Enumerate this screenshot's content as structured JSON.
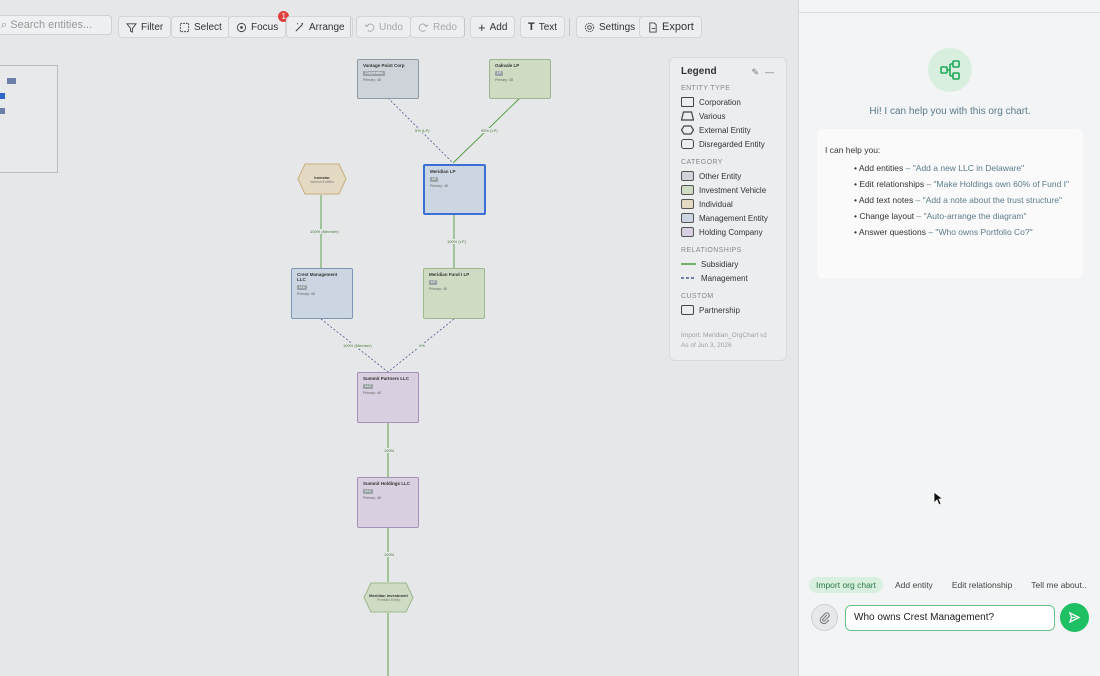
{
  "toolbar": {
    "search_placeholder": "Search entities...",
    "filter": "Filter",
    "select": "Select",
    "focus": "Focus",
    "focus_badge": "1",
    "arrange": "Arrange",
    "undo": "Undo",
    "redo": "Redo",
    "add": "Add",
    "text": "Text",
    "settings": "Settings",
    "export": "Export"
  },
  "nodes": {
    "vantage": {
      "name": "Vantage Point Corp",
      "tag": "Corporation",
      "line": "Primary: 48"
    },
    "oakvale": {
      "name": "Oakvale LP",
      "tag": "LP",
      "line": "Primary: 48"
    },
    "investor": {
      "name": "Investor",
      "line": "Various Entities"
    },
    "meridian": {
      "name": "Meridian LP",
      "tag": "LP",
      "line": "Primary: 48"
    },
    "crest": {
      "name": "Crest Management LLC",
      "tag": "LLC",
      "line": "Primary: 48"
    },
    "fund": {
      "name": "Meridian Fund I LP",
      "tag": "LP",
      "line": "Primary: 48"
    },
    "partners": {
      "name": "Summit Partners LLC",
      "tag": "LLC",
      "line": "Primary: 48"
    },
    "holdings": {
      "name": "Summit Holdings LLC",
      "tag": "LLC",
      "line": "Primary: 48"
    },
    "portfolio": {
      "name": "Meridian Investment",
      "line": "Portfolio Entity"
    }
  },
  "edges": {
    "e1": "5% (LP)",
    "e2": "95% (LP)",
    "e3": "100% (Member)",
    "e4": "100% (LP)",
    "e5": "100% (Member)",
    "e6": "0%",
    "e7": "100%",
    "e8": "100%"
  },
  "legend": {
    "title": "Legend",
    "entity_type_heading": "ENTITY TYPE",
    "entity_types": [
      "Corporation",
      "Various",
      "External Entity",
      "Disregarded Entity"
    ],
    "category_heading": "CATEGORY",
    "categories": [
      {
        "label": "Other Entity",
        "color": "#cdd3d8"
      },
      {
        "label": "Investment Vehicle",
        "color": "#cfdcc3"
      },
      {
        "label": "Individual",
        "color": "#e4d9c3"
      },
      {
        "label": "Management Entity",
        "color": "#ccd6e2"
      },
      {
        "label": "Holding Company",
        "color": "#d8cfe0"
      }
    ],
    "relationships_heading": "RELATIONSHIPS",
    "relationships": [
      "Subsidiary",
      "Management"
    ],
    "custom_heading": "CUSTOM",
    "custom": [
      "Partnership"
    ],
    "footer_line1": "Import: Meridian_OrgChart v2",
    "footer_line2": "As of Jun 3, 2026"
  },
  "chat": {
    "greeting": "Hi! I can help you with this org chart.",
    "help_title": "I can help you:",
    "help_items": [
      {
        "label": "• Add entities",
        "example": "– \"Add a new LLC in Delaware\""
      },
      {
        "label": "• Edit relationships",
        "example": "– \"Make Holdings own 60% of Fund I\""
      },
      {
        "label": "• Add text notes",
        "example": "– \"Add a note about the trust structure\""
      },
      {
        "label": "• Change layout",
        "example": "– \"Auto-arrange the diagram\""
      },
      {
        "label": "• Answer questions",
        "example": "– \"Who owns Portfolio Co?\""
      }
    ],
    "suggestions": [
      "Import org chart",
      "Add entity",
      "Edit relationship",
      "Tell me about.."
    ],
    "input_value": "Who owns Crest Management?"
  }
}
